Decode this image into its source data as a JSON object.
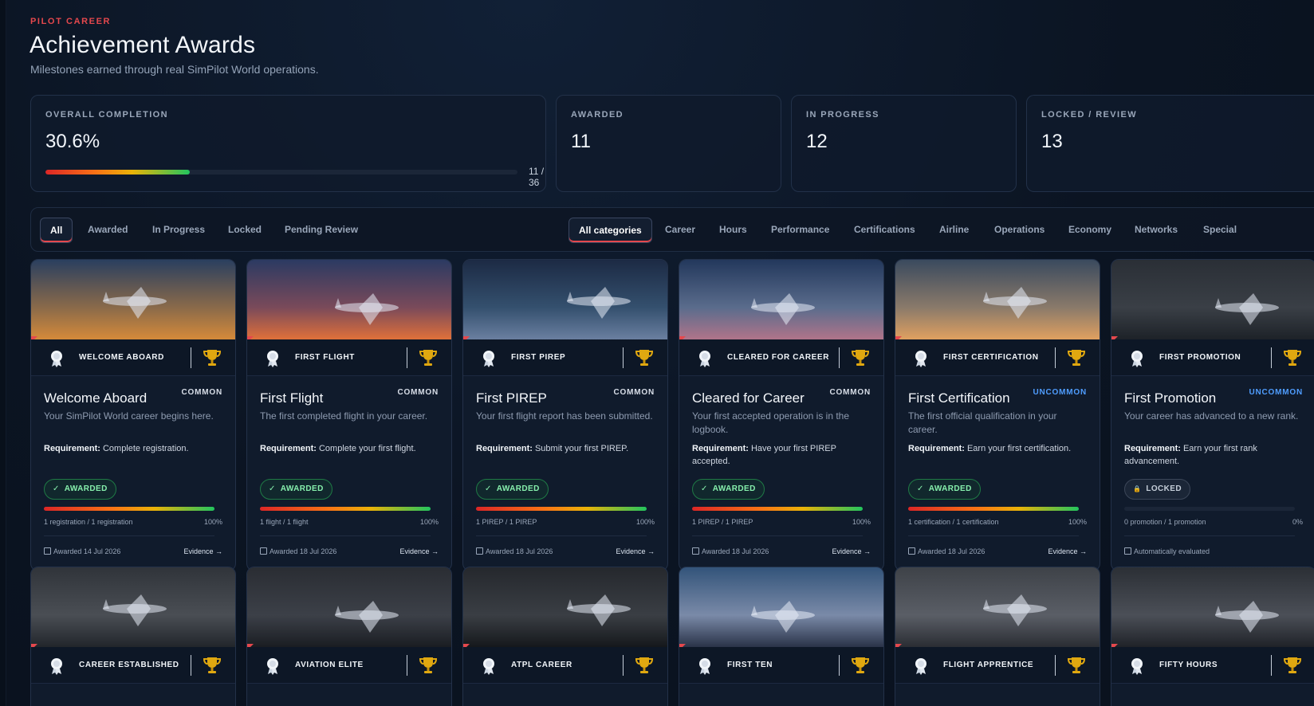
{
  "header": {
    "eyebrow": "PILOT CAREER",
    "title": "Achievement Awards",
    "subtitle": "Milestones earned through real SimPilot World operations."
  },
  "stats": {
    "overall": {
      "label": "OVERALL COMPLETION",
      "value": "30.6%",
      "progress": 0.306,
      "count": "11 / 36"
    },
    "awarded": {
      "label": "AWARDED",
      "value": "11"
    },
    "in_progress": {
      "label": "IN PROGRESS",
      "value": "12"
    },
    "locked": {
      "label": "LOCKED / REVIEW",
      "value": "13"
    }
  },
  "status_filters": [
    "All",
    "Awarded",
    "In Progress",
    "Locked",
    "Pending Review"
  ],
  "category_filters": [
    "All categories",
    "Career",
    "Hours",
    "Performance",
    "Certifications",
    "Airline",
    "Operations",
    "Economy",
    "Networks",
    "Special"
  ],
  "cards": [
    {
      "badge": "WELCOME ABOARD",
      "title": "Welcome Aboard",
      "rarity": "COMMON",
      "desc": "Your SimPilot World career begins here.",
      "req_label": "Requirement:",
      "req": "Complete registration.",
      "status": "AWARDED",
      "status_icon": "✓",
      "progress": 1.0,
      "progress_text": "1 registration / 1 registration",
      "pct": "100%",
      "footer": "Awarded 14 Jul 2026",
      "evidence": "Evidence →"
    },
    {
      "badge": "FIRST FLIGHT",
      "title": "First Flight",
      "rarity": "COMMON",
      "desc": "The first completed flight in your career.",
      "req_label": "Requirement:",
      "req": "Complete your first flight.",
      "status": "AWARDED",
      "status_icon": "✓",
      "progress": 1.0,
      "progress_text": "1 flight / 1 flight",
      "pct": "100%",
      "footer": "Awarded 18 Jul 2026",
      "evidence": "Evidence →"
    },
    {
      "badge": "FIRST PIREP",
      "title": "First PIREP",
      "rarity": "COMMON",
      "desc": "Your first flight report has been submitted.",
      "req_label": "Requirement:",
      "req": "Submit your first PIREP.",
      "status": "AWARDED",
      "status_icon": "✓",
      "progress": 1.0,
      "progress_text": "1 PIREP / 1 PIREP",
      "pct": "100%",
      "footer": "Awarded 18 Jul 2026",
      "evidence": "Evidence →"
    },
    {
      "badge": "CLEARED FOR CAREER",
      "title": "Cleared for Career",
      "rarity": "COMMON",
      "desc": "Your first accepted operation is in the logbook.",
      "req_label": "Requirement:",
      "req": "Have your first PIREP accepted.",
      "status": "AWARDED",
      "status_icon": "✓",
      "progress": 1.0,
      "progress_text": "1 PIREP / 1 PIREP",
      "pct": "100%",
      "footer": "Awarded 18 Jul 2026",
      "evidence": "Evidence →"
    },
    {
      "badge": "FIRST CERTIFICATION",
      "title": "First Certification",
      "rarity": "UNCOMMON",
      "desc": "The first official qualification in your career.",
      "req_label": "Requirement:",
      "req": "Earn your first certification.",
      "status": "AWARDED",
      "status_icon": "✓",
      "progress": 1.0,
      "progress_text": "1 certification / 1 certification",
      "pct": "100%",
      "footer": "Awarded 18 Jul 2026",
      "evidence": "Evidence →"
    },
    {
      "badge": "FIRST PROMOTION",
      "title": "First Promotion",
      "rarity": "UNCOMMON",
      "desc": "Your career has advanced to a new rank.",
      "req_label": "Requirement:",
      "req": "Earn your first rank advancement.",
      "status": "LOCKED",
      "status_icon": "🔒",
      "progress": 0,
      "progress_text": "0 promotion / 1 promotion",
      "pct": "0%",
      "footer": "Automatically evaluated",
      "evidence": ""
    },
    {
      "badge": "CAREER ESTABLISHED"
    },
    {
      "badge": "AVIATION ELITE"
    },
    {
      "badge": "ATPL CAREER"
    },
    {
      "badge": "FIRST TEN"
    },
    {
      "badge": "FLIGHT APPRENTICE"
    },
    {
      "badge": "FIFTY HOURS"
    }
  ],
  "colors": {
    "accent": "#e5484d",
    "uncommon": "#4f9dff",
    "awarded": "#86efac",
    "gold": "#e0a810"
  },
  "icons": {
    "medal": "medal-icon",
    "trophy": "trophy-icon",
    "check": "check-icon",
    "lock": "lock-icon",
    "calendar": "calendar-icon",
    "arrow": "arrow-right-icon"
  }
}
